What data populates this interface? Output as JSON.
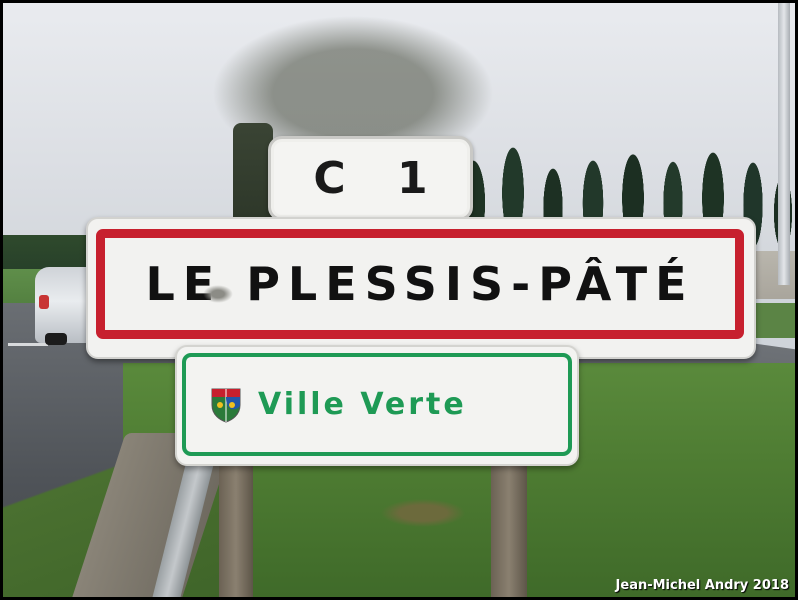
{
  "signs": {
    "route": "C 1",
    "town": "LE PLESSIS-PÂTÉ",
    "label": "Ville Verte"
  },
  "colors": {
    "town_border": "#c7202e",
    "label_green": "#1e9a55",
    "sign_face": "#f2f2f0"
  },
  "icons": {
    "crest": "coat-of-arms-icon"
  },
  "photo_credit": "Jean-Michel Andry 2018"
}
